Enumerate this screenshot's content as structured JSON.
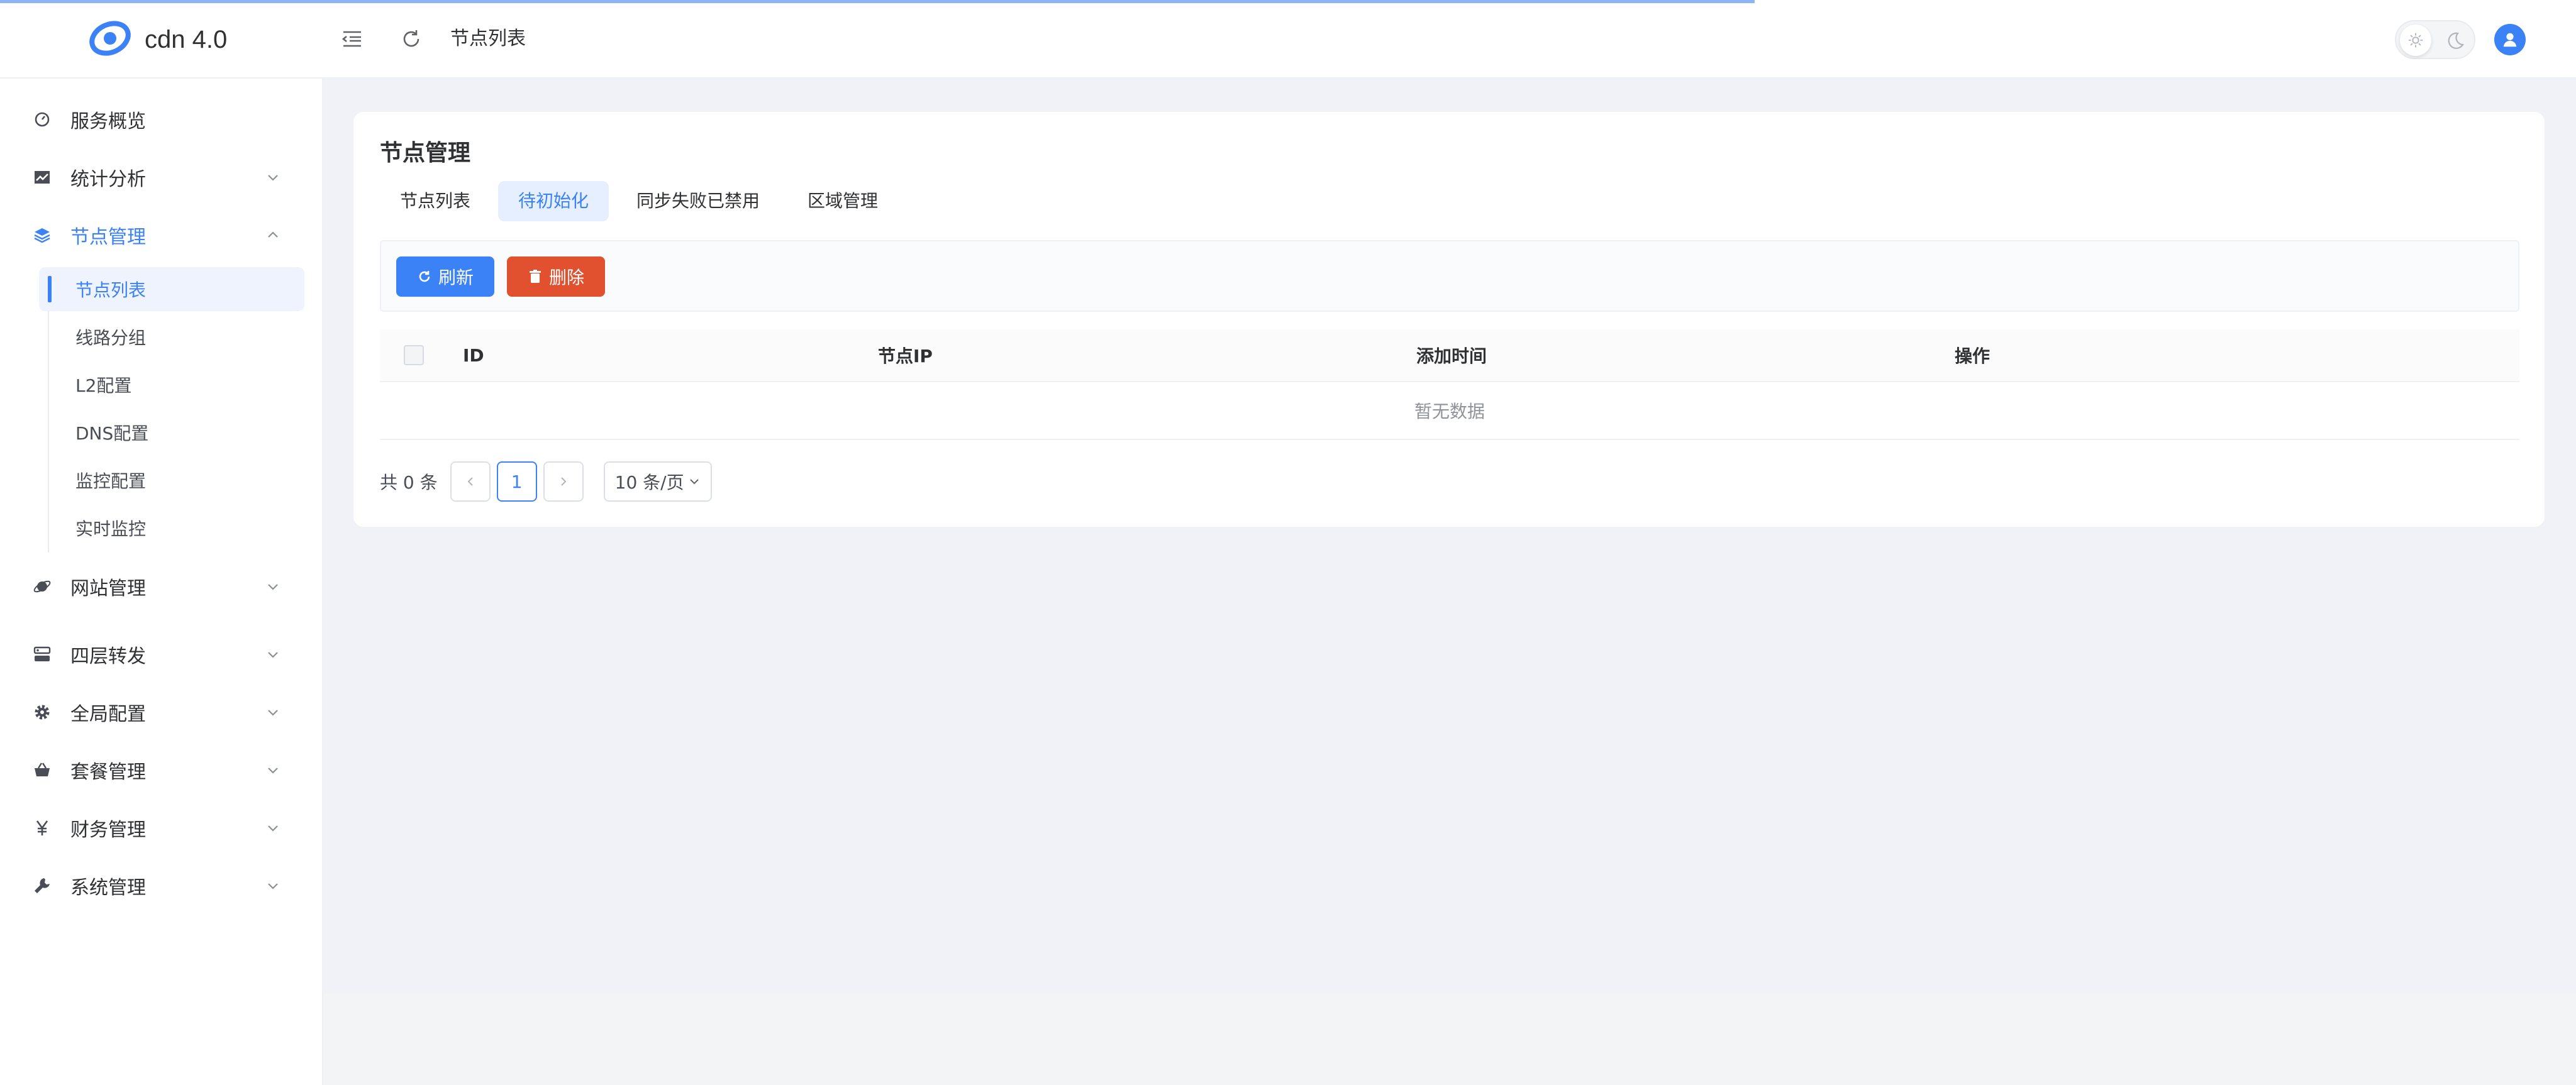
{
  "app": {
    "name": "cdn 4.0"
  },
  "header": {
    "breadcrumb": "节点列表"
  },
  "sidebar": {
    "items": [
      {
        "label": "服务概览",
        "icon": "dashboard-icon"
      },
      {
        "label": "统计分析",
        "icon": "chart-icon"
      },
      {
        "label": "节点管理",
        "icon": "layers-icon"
      },
      {
        "label": "网站管理",
        "icon": "globe-icon"
      },
      {
        "label": "四层转发",
        "icon": "server-icon"
      },
      {
        "label": "全局配置",
        "icon": "gear-icon"
      },
      {
        "label": "套餐管理",
        "icon": "basket-icon"
      },
      {
        "label": "财务管理",
        "icon": "yen-icon"
      },
      {
        "label": "系统管理",
        "icon": "wrench-icon"
      }
    ],
    "node_submenu": [
      {
        "label": "节点列表"
      },
      {
        "label": "线路分组"
      },
      {
        "label": "L2配置"
      },
      {
        "label": "DNS配置"
      },
      {
        "label": "监控配置"
      },
      {
        "label": "实时监控"
      }
    ]
  },
  "main": {
    "title": "节点管理",
    "tabs": [
      {
        "label": "节点列表"
      },
      {
        "label": "待初始化"
      },
      {
        "label": "同步失败已禁用"
      },
      {
        "label": "区域管理"
      }
    ],
    "toolbar": {
      "refresh_label": "刷新",
      "delete_label": "删除"
    },
    "table": {
      "columns": [
        "ID",
        "节点IP",
        "添加时间",
        "操作"
      ],
      "empty_text": "暂无数据"
    },
    "pagination": {
      "total_text": "共 0 条",
      "current_page": "1",
      "page_size": "10 条/页"
    }
  },
  "colors": {
    "accent": "#3b82f6",
    "danger": "#e1512f"
  }
}
